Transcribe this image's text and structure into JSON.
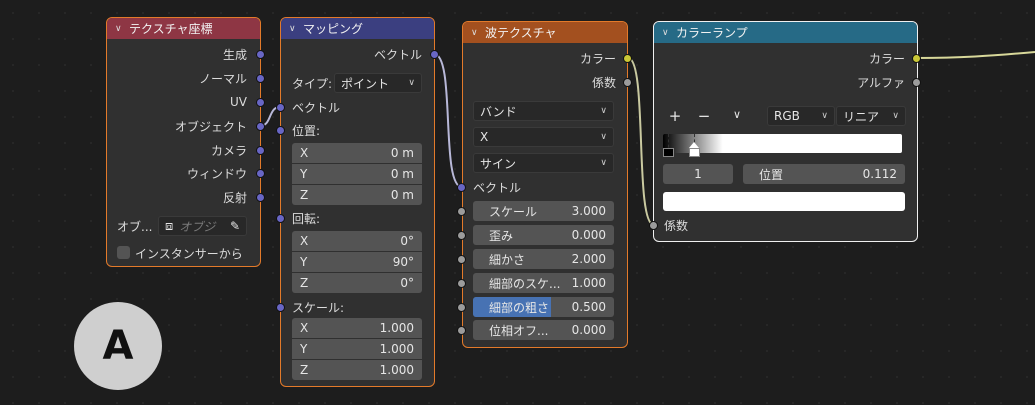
{
  "nodes": {
    "texcoord": {
      "title": "テクスチャ座標",
      "outputs": [
        "生成",
        "ノーマル",
        "UV",
        "オブジェクト",
        "カメラ",
        "ウィンドウ",
        "反射"
      ],
      "object_label": "オブ...",
      "object_placeholder": "オブジ",
      "instancer_label": "インスタンサーから"
    },
    "mapping": {
      "title": "マッピング",
      "output": "ベクトル",
      "type_label": "タイプ:",
      "type_value": "ポイント",
      "vector_input": "ベクトル",
      "location": {
        "label": "位置:",
        "x": "0 m",
        "y": "0 m",
        "z": "0 m"
      },
      "rotation": {
        "label": "回転:",
        "x": "0°",
        "y": "90°",
        "z": "0°"
      },
      "scale": {
        "label": "スケール:",
        "x": "1.000",
        "y": "1.000",
        "z": "1.000"
      },
      "axis": {
        "x": "X",
        "y": "Y",
        "z": "Z"
      }
    },
    "wave": {
      "title": "波テクスチャ",
      "outputs": [
        "カラー",
        "係数"
      ],
      "dropdowns": [
        "バンド",
        "X",
        "サイン"
      ],
      "vector_input": "ベクトル",
      "params": [
        {
          "label": "スケール",
          "value": "3.000"
        },
        {
          "label": "歪み",
          "value": "0.000"
        },
        {
          "label": "細かさ",
          "value": "2.000"
        },
        {
          "label": "細部のスケ...",
          "value": "1.000"
        },
        {
          "label": "細部の粗さ",
          "value": "0.500"
        },
        {
          "label": "位相オフ...",
          "value": "0.000"
        }
      ]
    },
    "colorramp": {
      "title": "カラーランプ",
      "outputs": [
        "カラー",
        "アルファ"
      ],
      "add_icon": "+",
      "remove_icon": "−",
      "menu_icon": "∨",
      "color_mode": "RGB",
      "interpolation": "リニア",
      "stop_index": "1",
      "position_label": "位置",
      "position_value": "0.112",
      "factor_input": "係数"
    }
  },
  "badge": "A",
  "colors": {
    "texcoord_header": "#8e3644",
    "mapping_header": "#3b3f80",
    "wave_header": "#a3501f",
    "colorramp_header": "#266a86",
    "socket_vector": "#6866c4",
    "socket_float": "#9c9c9c",
    "socket_color": "#c9c737",
    "highlight": "#4772b3"
  }
}
